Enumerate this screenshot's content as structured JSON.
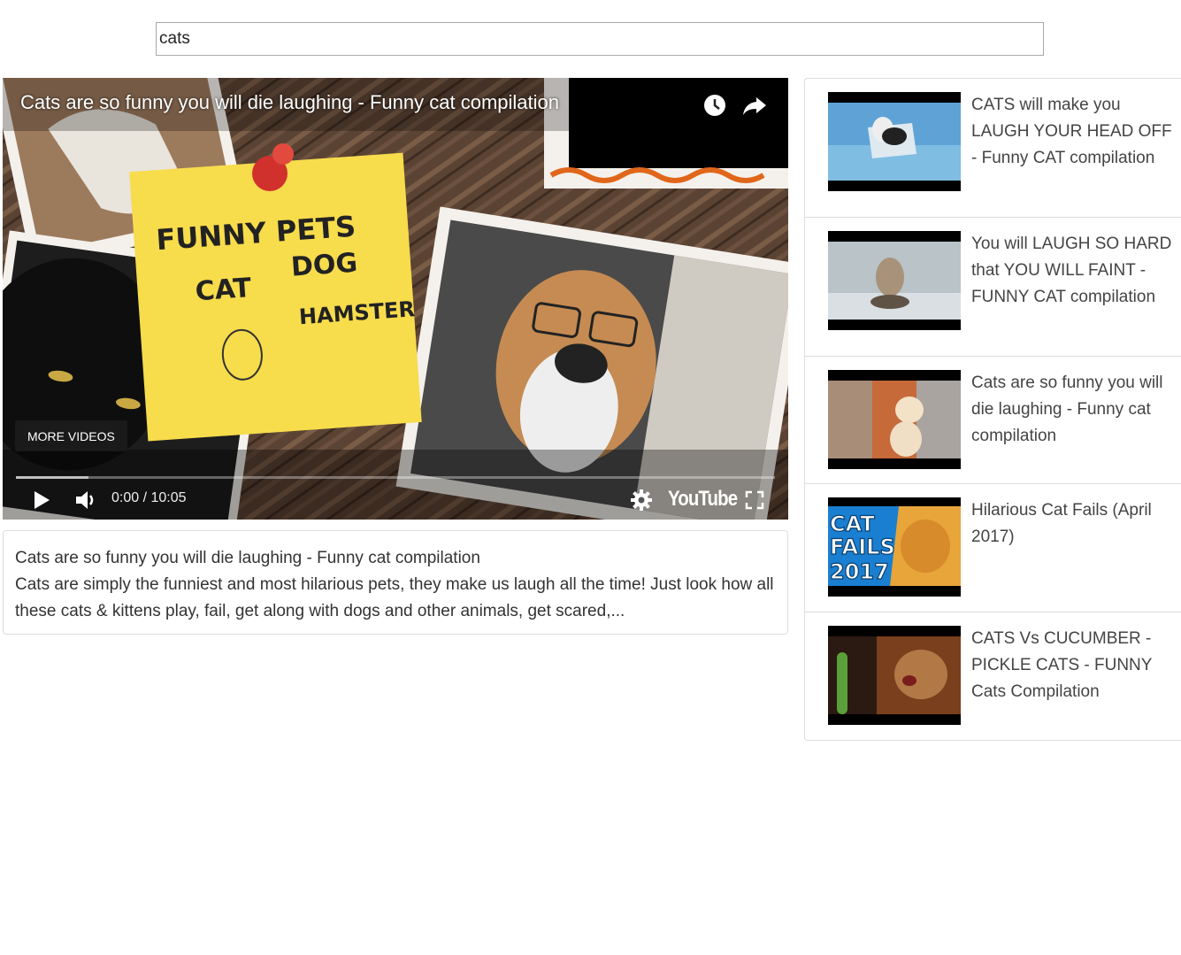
{
  "search": {
    "value": "cats"
  },
  "player": {
    "title": "Cats are so funny you will die laughing - Funny cat compilation",
    "more_videos_label": "MORE VIDEOS",
    "current_time": "0:00",
    "duration": "10:05",
    "time_separator": " / ",
    "brand": "YouTube",
    "progress_loaded_fraction": 0.095,
    "note": {
      "line1": "FUNNY PETS",
      "line2": "CAT",
      "line3": "DOG",
      "line4": "HAMSTER"
    }
  },
  "description": {
    "title": "Cats are so funny you will die laughing - Funny cat compilation",
    "text": "Cats are simply the funniest and most hilarious pets, they make us laugh all the time! Just look how all these cats & kittens play, fail, get along with dogs and other animals, get scared,..."
  },
  "related": [
    {
      "title": "CATS will make you LAUGH YOUR HEAD OFF - Funny CAT compilation"
    },
    {
      "title": "You will LAUGH SO HARD that YOU WILL FAINT - FUNNY CAT compilation"
    },
    {
      "title": "Cats are so funny you will die laughing - Funny cat compilation"
    },
    {
      "title": "Hilarious Cat Fails (April 2017)",
      "thumb_text": [
        "CAT",
        "FAILS",
        "2017"
      ]
    },
    {
      "title": "CATS Vs CUCUMBER - PICKLE CATS - FUNNY Cats Compilation"
    }
  ],
  "colors": {
    "note_yellow": "#f7dc4c",
    "pin_red": "#d0312d",
    "wood": "#5b4334"
  }
}
